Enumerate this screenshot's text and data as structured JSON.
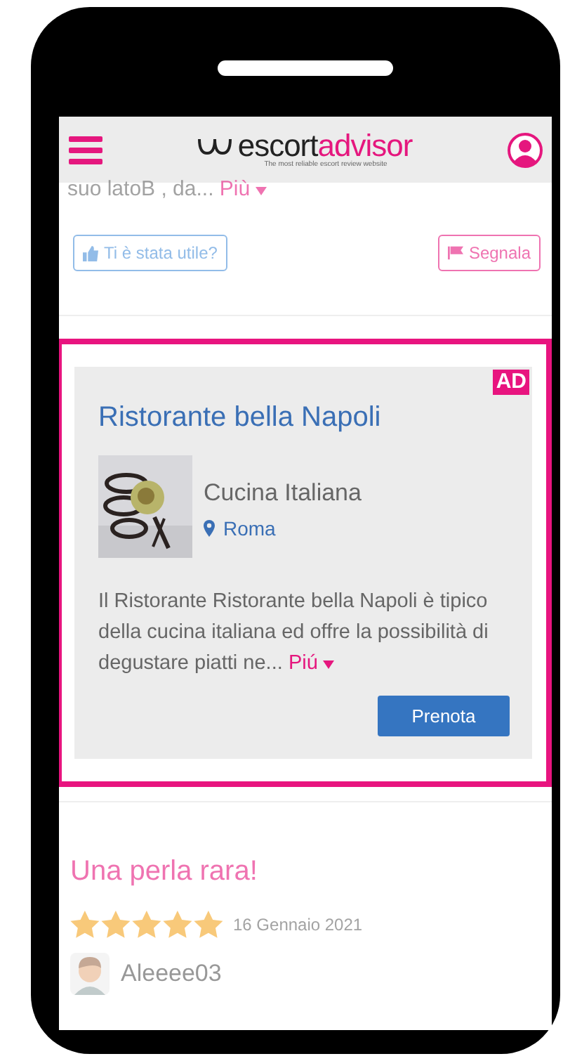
{
  "header": {
    "logo_dark": "escort",
    "logo_accent": "advisor",
    "tagline": "The most reliable escort review website"
  },
  "previous_review": {
    "excerpt": "suo latoB , da...",
    "more": "Più",
    "useful_button": "Ti è stata utile?",
    "report_button": "Segnala"
  },
  "ad": {
    "badge": "AD",
    "title": "Ristorante bella Napoli",
    "cuisine": "Cucina Italiana",
    "city": "Roma",
    "description": "Il Ristorante Ristorante bella Napoli è tipico della cucina italiana ed offre la possibilità di degustare piatti ne...",
    "more": "Piú",
    "button": "Prenota"
  },
  "review": {
    "title": "Una perla rara!",
    "stars": 5,
    "date": "16 Gennaio 2021",
    "author": "Aleeee03"
  }
}
